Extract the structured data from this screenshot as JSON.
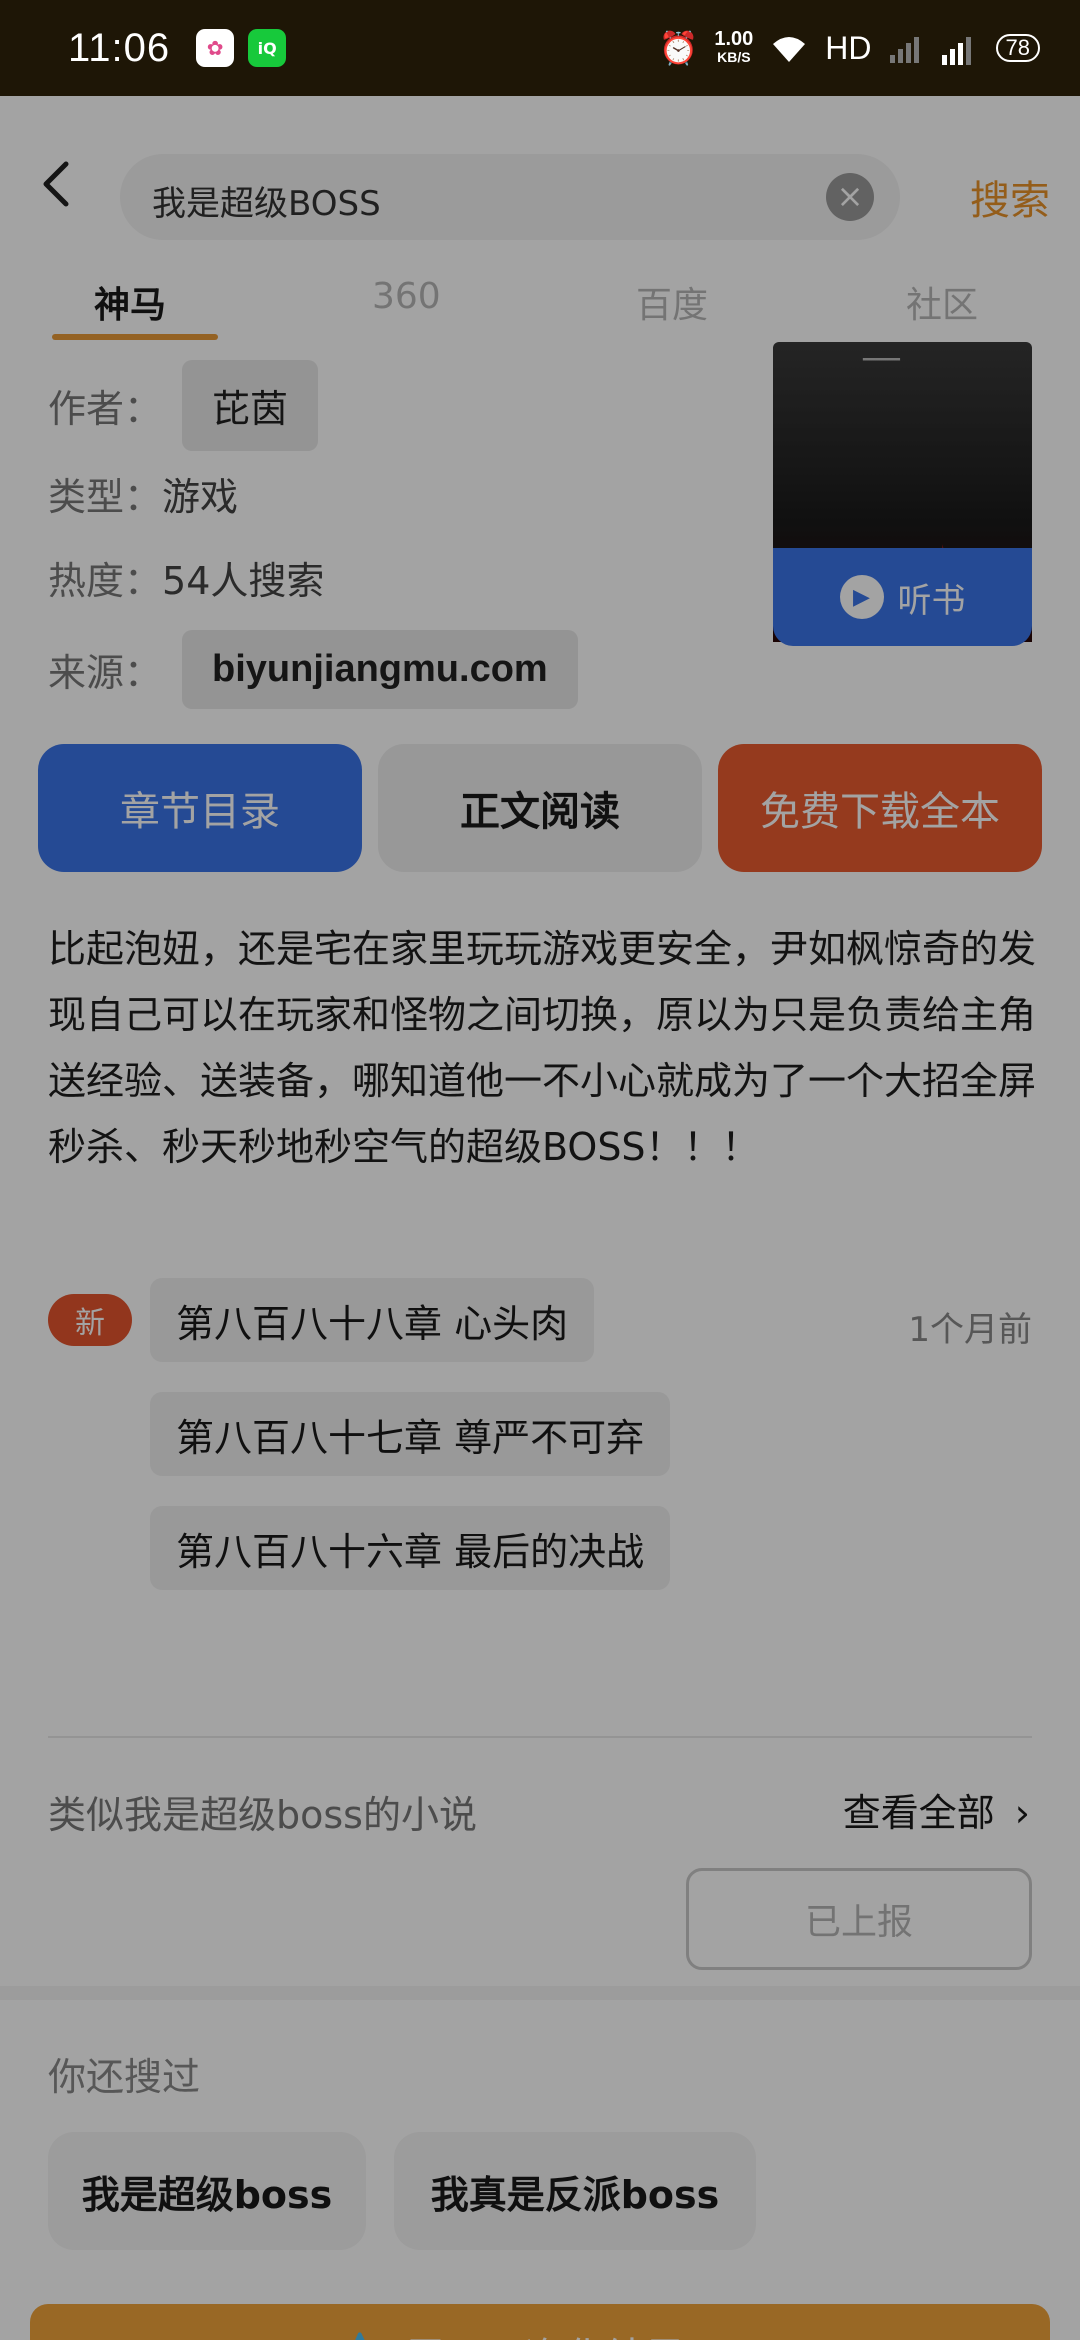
{
  "status": {
    "time": "11:06",
    "net_speed": "1.00",
    "net_unit": "KB/S",
    "hd": "HD",
    "battery": "78"
  },
  "search": {
    "query": "我是超级BOSS",
    "button": "搜索"
  },
  "tabs": [
    {
      "label": "神马"
    },
    {
      "label": "360"
    },
    {
      "label": "百度"
    },
    {
      "label": "社区"
    }
  ],
  "book": {
    "author_label": "作者：",
    "author": "芘茵",
    "type_label": "类型：",
    "type": "游戏",
    "heat_label": "热度：",
    "heat": "54人搜索",
    "source_label": "来源：",
    "source": "biyunjiangmu.com",
    "listen": "听书",
    "description": "比起泡妞，还是宅在家里玩玩游戏更安全，尹如枫惊奇的发现自己可以在玩家和怪物之间切换，原以为只是负责给主角送经验、送装备，哪知道他一不小心就成为了一个大招全屏秒杀、秒天秒地秒空气的超级BOSS！！！"
  },
  "actions": {
    "catalog": "章节目录",
    "read": "正文阅读",
    "download": "免费下载全本"
  },
  "chapters": {
    "new_badge": "新",
    "time": "1个月前",
    "items": [
      {
        "title": "第八百八十八章 心头肉"
      },
      {
        "title": "第八百八十七章 尊严不可弃"
      },
      {
        "title": "第八百八十六章 最后的决战"
      }
    ]
  },
  "similar": {
    "title": "类似我是超级boss的小说",
    "view_all": "查看全部",
    "reported": "已上报"
  },
  "history": {
    "title": "你还搜过",
    "items": [
      {
        "label": "我是超级boss"
      },
      {
        "label": "我真是反派boss"
      }
    ]
  },
  "expand": {
    "label": "展开可净化结果"
  },
  "colors": {
    "accent": "#e8922a",
    "blue": "#3b74e8",
    "red": "#e95b30"
  }
}
